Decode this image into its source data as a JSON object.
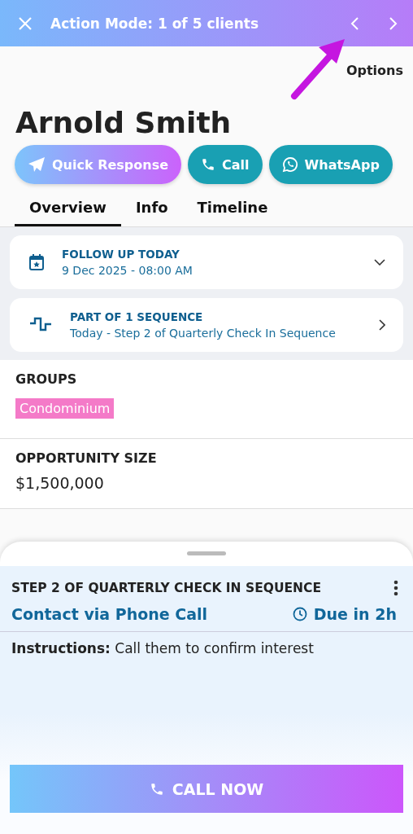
{
  "top_bar": {
    "title": "Action Mode: 1 of 5 clients"
  },
  "options_label": "Options",
  "client": {
    "name": "Arnold Smith"
  },
  "actions": [
    {
      "kind": "quick_response",
      "label": "Quick Response"
    },
    {
      "kind": "call",
      "label": "Call"
    },
    {
      "kind": "whatsapp",
      "label": "WhatsApp"
    }
  ],
  "tabs": [
    {
      "label": "Overview",
      "selected": true
    },
    {
      "label": "Info",
      "selected": false
    },
    {
      "label": "Timeline",
      "selected": false
    }
  ],
  "cards": [
    {
      "kind": "follow_up",
      "title": "FOLLOW UP TODAY",
      "subtitle": "9 Dec 2025 - 08:00 AM"
    },
    {
      "kind": "sequence",
      "title": "PART OF 1 SEQUENCE",
      "subtitle": "Today - Step 2 of Quarterly Check In Sequence"
    }
  ],
  "groups": {
    "heading": "GROUPS",
    "tags": [
      {
        "label": "Condominium",
        "color": "#f47ac8"
      }
    ]
  },
  "opportunity": {
    "heading": "OPPORTUNITY SIZE",
    "value": "$1,500,000"
  },
  "sheet": {
    "title": "STEP 2 OF QUARTERLY CHECK IN SEQUENCE",
    "method": "Contact via Phone Call",
    "due": "Due in 2h",
    "instructions": "**Instructions:** Call them to confirm interest",
    "button": "CALL NOW"
  }
}
